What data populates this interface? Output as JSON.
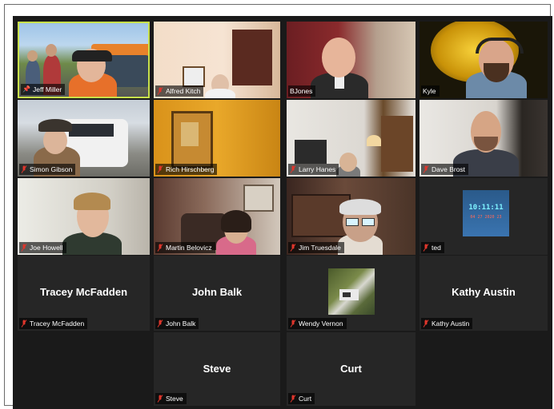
{
  "participants": [
    {
      "name": "Jeff Miller",
      "muted": false,
      "pinned": true,
      "active": true
    },
    {
      "name": "Alfred Kitch",
      "muted": true
    },
    {
      "name": "BJones",
      "muted": false
    },
    {
      "name": "Kyle",
      "muted": false
    },
    {
      "name": "Simon Gibson",
      "muted": true
    },
    {
      "name": "Rich Hirschberg",
      "muted": true
    },
    {
      "name": "Larry Hanes",
      "muted": true
    },
    {
      "name": "Dave Brost",
      "muted": true
    },
    {
      "name": "Joe Howell",
      "muted": true
    },
    {
      "name": "Martin Belovicz",
      "muted": true
    },
    {
      "name": "Jim Truesdale",
      "muted": true
    },
    {
      "name": "ted",
      "muted": true
    },
    {
      "name": "Tracey McFadden",
      "muted": true,
      "video_off": true,
      "display_name": "Tracey McFadden"
    },
    {
      "name": "John Balk",
      "muted": true,
      "video_off": true,
      "display_name": "John Balk"
    },
    {
      "name": "Wendy Vernon",
      "muted": true
    },
    {
      "name": "Kathy Austin",
      "muted": true,
      "video_off": true,
      "display_name": "Kathy Austin"
    },
    {
      "name": "Steve",
      "muted": true,
      "video_off": true,
      "display_name": "Steve"
    },
    {
      "name": "Curt",
      "muted": true,
      "video_off": true,
      "display_name": "Curt"
    }
  ],
  "ted_clock": {
    "time": "10:11:11",
    "date": "04 27 2020 23"
  },
  "colors": {
    "active_border": "#c8e04a",
    "muted_icon": "#e0362c",
    "tile_bg": "#262626"
  }
}
